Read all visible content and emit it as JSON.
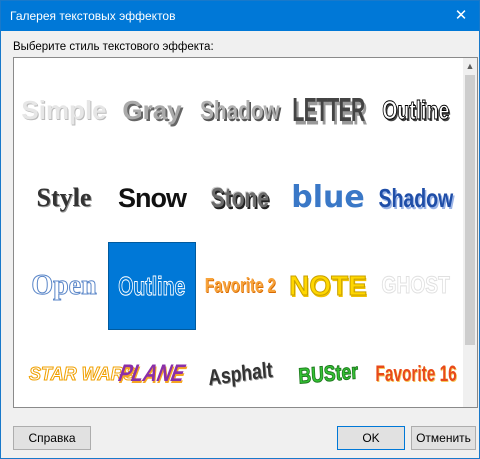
{
  "window": {
    "title": "Галерея текстовых эффектов",
    "close_symbol": "✕"
  },
  "gallery": {
    "label": "Выберите стиль текстового эффекта:",
    "items": [
      "Simple",
      "Gray",
      "Shadow",
      "LETTER",
      "Outline",
      "Style",
      "Snow",
      "Stone",
      "blue",
      "Shadow",
      "Open",
      "Outline",
      "Favorite 2",
      "NOTE",
      "GHOST",
      "STAR WARS",
      "PLANE",
      "Asphalt",
      "BUSter",
      "Favorite 16"
    ],
    "selected_index": 11
  },
  "buttons": {
    "help": "Справка",
    "ok": "OK",
    "cancel": "Отменить"
  },
  "colors": {
    "titlebar": "#0078d7",
    "selection": "#0078d7"
  },
  "icons": {
    "scroll_up": "chevron-up-icon",
    "close": "close-icon"
  }
}
